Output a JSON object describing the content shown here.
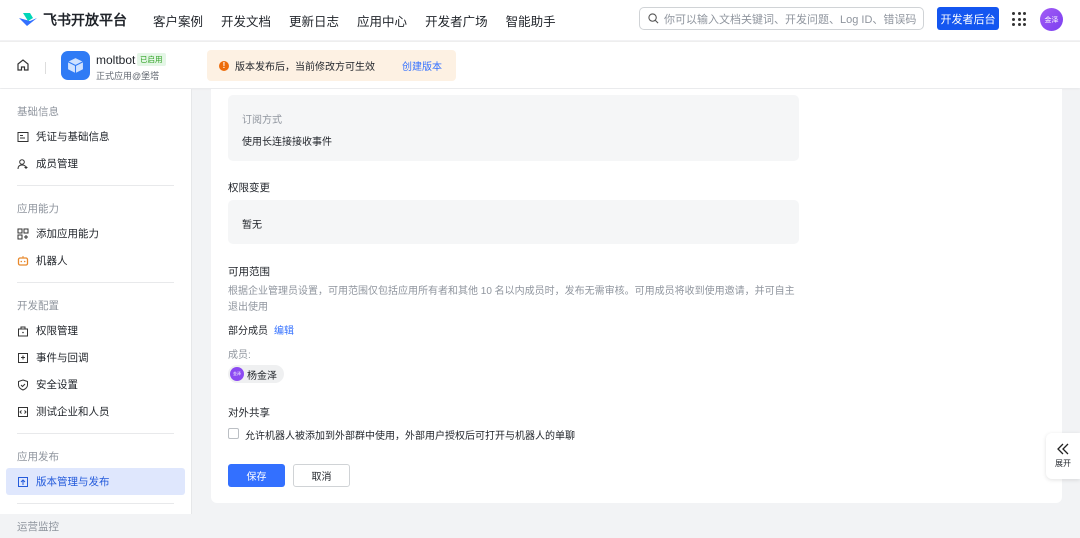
{
  "header": {
    "brand": "飞书开放平台",
    "nav": [
      "客户案例",
      "开发文档",
      "更新日志",
      "应用中心",
      "开发者广场",
      "智能助手"
    ],
    "search_placeholder": "你可以输入文档关键词、开发问题、Log ID、错误码",
    "dev_console": "开发者后台",
    "avatar_text": "金泽"
  },
  "app": {
    "name": "moltbot",
    "status": "已启用",
    "subtitle": "正式应用@堡塔"
  },
  "notice": {
    "text": "版本发布后，当前修改方可生效",
    "link": "创建版本"
  },
  "sidebar": {
    "sections": [
      {
        "title": "基础信息",
        "items": [
          "凭证与基础信息",
          "成员管理"
        ]
      },
      {
        "title": "应用能力",
        "items": [
          "添加应用能力",
          "机器人"
        ]
      },
      {
        "title": "开发配置",
        "items": [
          "权限管理",
          "事件与回调",
          "安全设置",
          "测试企业和人员"
        ]
      },
      {
        "title": "应用发布",
        "items": [
          "版本管理与发布"
        ]
      },
      {
        "title": "运营监控",
        "items": []
      }
    ],
    "active": "版本管理与发布"
  },
  "main": {
    "subscription": {
      "label": "订阅方式",
      "value": "使用长连接接收事件"
    },
    "permission": {
      "title": "权限变更",
      "value": "暂无"
    },
    "scope": {
      "title": "可用范围",
      "desc": "根据企业管理员设置，可用范围仅包括应用所有者和其他 10 名以内成员时，发布无需审核。可用成员将收到使用邀请，并可自主退出使用",
      "mode": "部分成员",
      "edit": "编辑",
      "members_label": "成员:",
      "members": [
        {
          "name": "杨金泽",
          "avatar": "金泽"
        }
      ]
    },
    "sharing": {
      "title": "对外共享",
      "checkbox_label": "允许机器人被添加到外部群中使用，外部用户授权后可打开与机器人的单聊",
      "checked": false
    },
    "save": "保存",
    "cancel": "取消"
  },
  "expand": "展开",
  "colors": {
    "primary": "#1456f0",
    "link": "#3370ff",
    "active_bg": "#dfe7fd"
  }
}
